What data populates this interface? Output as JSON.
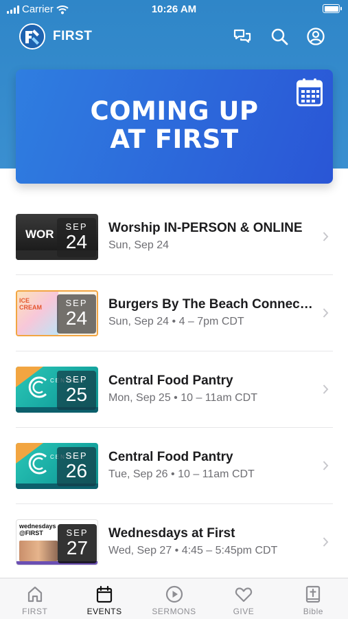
{
  "status_bar": {
    "carrier": "Carrier",
    "time": "10:26 AM"
  },
  "header": {
    "title": "FIRST"
  },
  "banner": {
    "line1": "COMING UP",
    "line2": "AT FIRST"
  },
  "events": [
    {
      "title": "Worship IN-PERSON & ONLINE",
      "subtitle": "Sun, Sep 24",
      "month": "SEP",
      "day": "24",
      "thumb_text": "WOR"
    },
    {
      "title": "Burgers By The Beach Connec…",
      "subtitle": "Sun, Sep 24 • 4 – 7pm CDT",
      "month": "SEP",
      "day": "24",
      "thumb_text": "ICE CREAM"
    },
    {
      "title": "Central Food Pantry",
      "subtitle": "Mon, Sep 25 • 10 – 11am CDT",
      "month": "SEP",
      "day": "25",
      "thumb_text": "CENTRAL"
    },
    {
      "title": "Central Food Pantry",
      "subtitle": "Tue, Sep 26 • 10 – 11am CDT",
      "month": "SEP",
      "day": "26",
      "thumb_text": "CENTRAL"
    },
    {
      "title": "Wednesdays at First",
      "subtitle": "Wed, Sep 27 • 4:45 – 5:45pm CDT",
      "month": "SEP",
      "day": "27",
      "thumb_text": "wednesdays @FIRST"
    }
  ],
  "tabs": [
    {
      "label": "FIRST",
      "icon": "home-icon",
      "active": false
    },
    {
      "label": "EVENTS",
      "icon": "calendar-icon",
      "active": true
    },
    {
      "label": "SERMONS",
      "icon": "play-circle-icon",
      "active": false
    },
    {
      "label": "GIVE",
      "icon": "heart-icon",
      "active": false
    },
    {
      "label": "Bible",
      "icon": "bible-icon",
      "active": false
    }
  ],
  "colors": {
    "header_blue": "#2f86c8",
    "banner_blue": "#2a56d6",
    "text_secondary": "#6e6e73"
  }
}
